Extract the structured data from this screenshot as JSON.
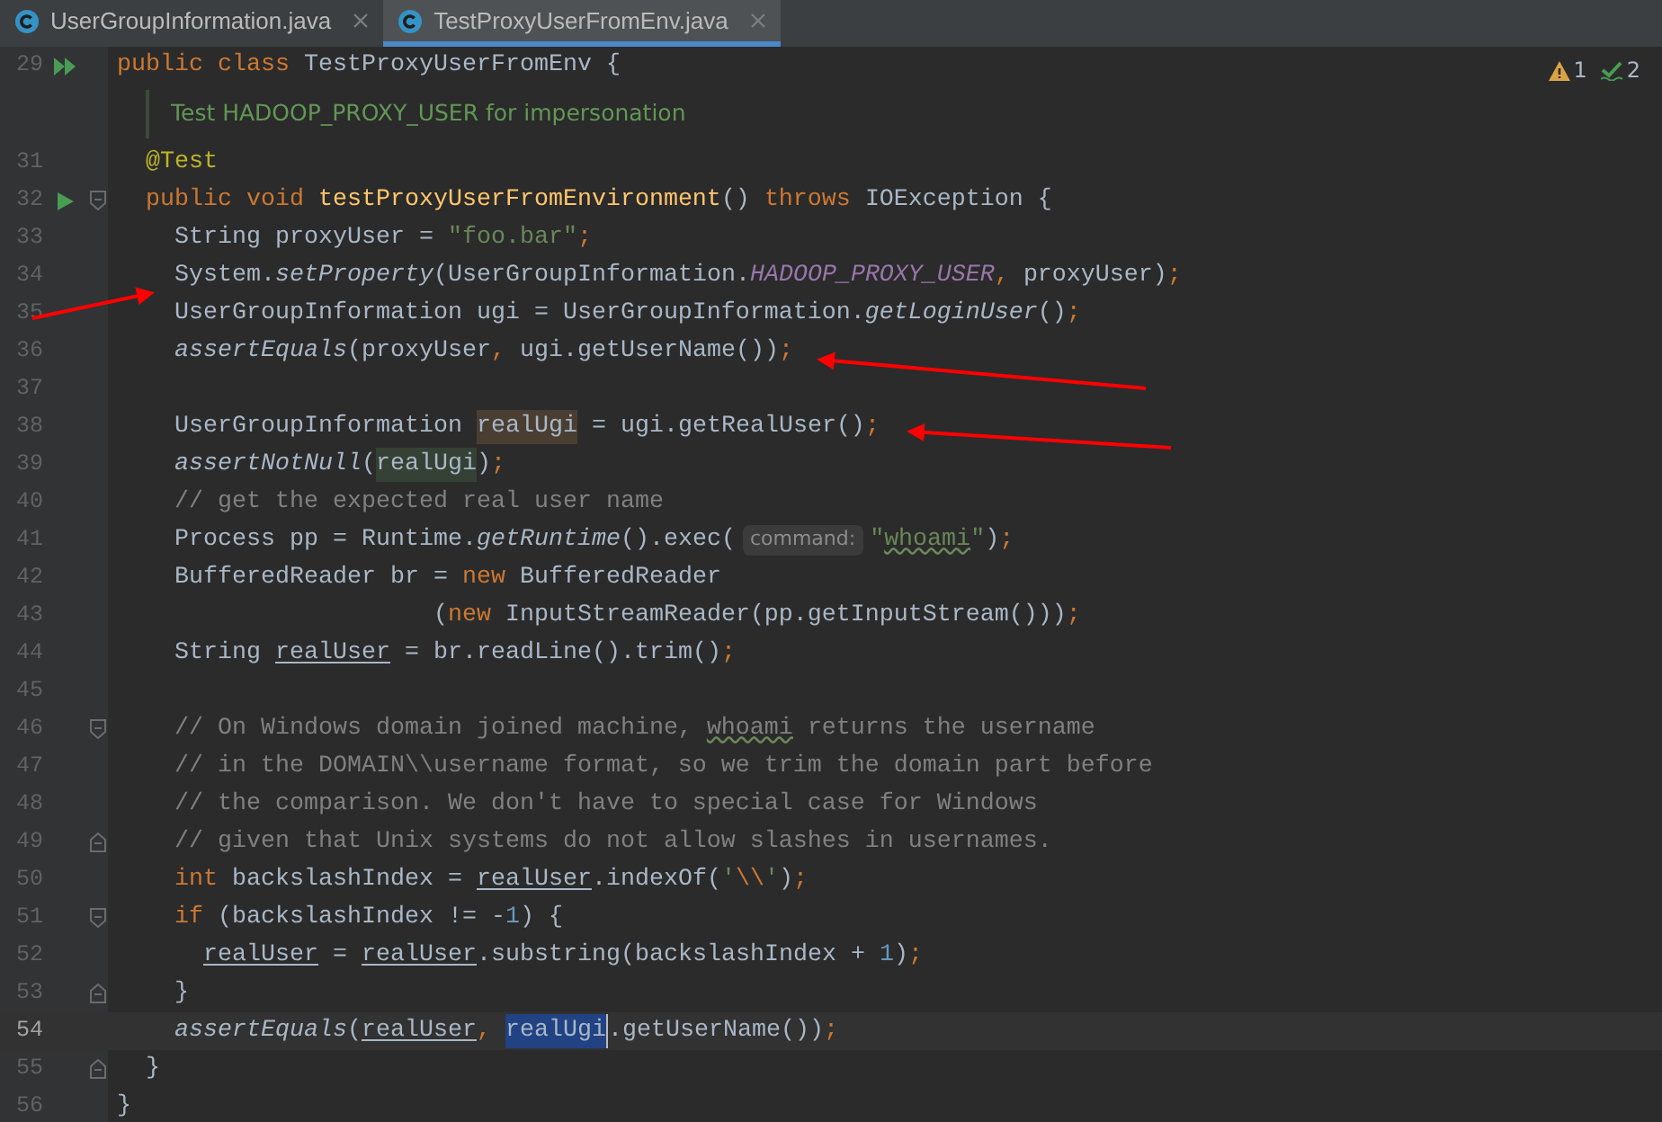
{
  "tabs": [
    {
      "label": "UserGroupInformation.java",
      "selected": false
    },
    {
      "label": "TestProxyUserFromEnv.java",
      "selected": true
    }
  ],
  "inspections": {
    "warnings": "1",
    "weak_warnings": "2"
  },
  "lines": [
    {
      "kind": "code",
      "number": "29",
      "run_all": true,
      "current": false,
      "tokens": [
        {
          "kind": "kw",
          "text": "public class "
        },
        {
          "kind": "plain",
          "text": "TestProxyUserFromEnv {"
        }
      ]
    },
    {
      "kind": "doc",
      "text": "Test HADOOP_PROXY_USER for impersonation"
    },
    {
      "kind": "code",
      "number": "31",
      "current": false,
      "tokens": [
        {
          "kind": "ann",
          "text": "  @Test"
        }
      ]
    },
    {
      "kind": "code",
      "number": "32",
      "run": true,
      "fold_start": true,
      "current": false,
      "tokens": [
        {
          "kind": "kw",
          "text": "  public void "
        },
        {
          "kind": "decl",
          "text": "testProxyUserFromEnvironment"
        },
        {
          "kind": "plain",
          "text": "() "
        },
        {
          "kind": "kw",
          "text": "throws "
        },
        {
          "kind": "plain",
          "text": "IOException {"
        }
      ]
    },
    {
      "kind": "code",
      "number": "33",
      "current": false,
      "tokens": [
        {
          "kind": "plain",
          "text": "    String proxyUser = "
        },
        {
          "kind": "str",
          "text": "\"foo.bar\""
        },
        {
          "kind": "kw",
          "text": ";"
        }
      ]
    },
    {
      "kind": "code",
      "number": "34",
      "current": false,
      "tokens": [
        {
          "kind": "plain",
          "text": "    System."
        },
        {
          "kind": "static",
          "text": "setProperty"
        },
        {
          "kind": "plain",
          "text": "(UserGroupInformation."
        },
        {
          "kind": "const",
          "text": "HADOOP_PROXY_USER"
        },
        {
          "kind": "kw",
          "text": ","
        },
        {
          "kind": "plain",
          "text": " proxyUser)"
        },
        {
          "kind": "kw",
          "text": ";"
        }
      ]
    },
    {
      "kind": "code",
      "number": "35",
      "current": false,
      "tokens": [
        {
          "kind": "plain",
          "text": "    UserGroupInformation ugi = UserGroupInformation."
        },
        {
          "kind": "static",
          "text": "getLoginUser"
        },
        {
          "kind": "plain",
          "text": "()"
        },
        {
          "kind": "kw",
          "text": ";"
        }
      ]
    },
    {
      "kind": "code",
      "number": "36",
      "current": false,
      "tokens": [
        {
          "kind": "static",
          "text": "    assertEquals"
        },
        {
          "kind": "plain",
          "text": "(proxyUser"
        },
        {
          "kind": "kw",
          "text": ","
        },
        {
          "kind": "plain",
          "text": " ugi.getUserName())"
        },
        {
          "kind": "kw",
          "text": ";"
        }
      ]
    },
    {
      "kind": "code",
      "number": "37",
      "current": false
    },
    {
      "kind": "code",
      "number": "38",
      "current": false,
      "tokens": [
        {
          "kind": "plain",
          "text": "    UserGroupInformation "
        },
        {
          "kind": "plain",
          "text": "realUgi",
          "write_highlight": true
        },
        {
          "kind": "plain",
          "text": " = ugi.getRealUser()"
        },
        {
          "kind": "kw",
          "text": ";"
        }
      ]
    },
    {
      "kind": "code",
      "number": "39",
      "current": false,
      "tokens": [
        {
          "kind": "static",
          "text": "    assertNotNull"
        },
        {
          "kind": "plain",
          "text": "("
        },
        {
          "kind": "plain",
          "text": "realUgi",
          "read_highlight": true
        },
        {
          "kind": "plain",
          "text": ")"
        },
        {
          "kind": "kw",
          "text": ";"
        }
      ]
    },
    {
      "kind": "code",
      "number": "40",
      "current": false,
      "tokens": [
        {
          "kind": "cmt",
          "text": "    // get the expected real user name"
        }
      ]
    },
    {
      "kind": "code",
      "number": "41",
      "current": false,
      "tokens": [
        {
          "kind": "plain",
          "text": "    Process pp = Runtime."
        },
        {
          "kind": "static",
          "text": "getRuntime"
        },
        {
          "kind": "plain",
          "text": "().exec("
        },
        {
          "kind": "hint",
          "text": "command:"
        },
        {
          "kind": "str",
          "text": "\""
        },
        {
          "kind": "str",
          "text": "whoami",
          "typo": true
        },
        {
          "kind": "str",
          "text": "\""
        },
        {
          "kind": "plain",
          "text": ")"
        },
        {
          "kind": "kw",
          "text": ";"
        }
      ]
    },
    {
      "kind": "code",
      "number": "42",
      "current": false,
      "tokens": [
        {
          "kind": "plain",
          "text": "    BufferedReader br = "
        },
        {
          "kind": "kw",
          "text": "new "
        },
        {
          "kind": "plain",
          "text": "BufferedReader"
        }
      ]
    },
    {
      "kind": "code",
      "number": "43",
      "current": false,
      "tokens": [
        {
          "kind": "plain",
          "text": "                      ("
        },
        {
          "kind": "kw",
          "text": "new "
        },
        {
          "kind": "plain",
          "text": "InputStreamReader(pp.getInputStream()))"
        },
        {
          "kind": "kw",
          "text": ";"
        }
      ]
    },
    {
      "kind": "code",
      "number": "44",
      "current": false,
      "tokens": [
        {
          "kind": "plain",
          "text": "    String "
        },
        {
          "kind": "var",
          "text": "realUser"
        },
        {
          "kind": "plain",
          "text": " = br.readLine().trim()"
        },
        {
          "kind": "kw",
          "text": ";"
        }
      ]
    },
    {
      "kind": "code",
      "number": "45",
      "current": false
    },
    {
      "kind": "code",
      "number": "46",
      "fold_start": true,
      "current": false,
      "tokens": [
        {
          "kind": "cmt",
          "text": "    // On Windows domain joined machine,"
        },
        {
          "kind": "cmt",
          "text": " whoami",
          "typo": true
        },
        {
          "kind": "cmt",
          "text": " returns the username"
        }
      ]
    },
    {
      "kind": "code",
      "number": "47",
      "current": false,
      "tokens": [
        {
          "kind": "cmt",
          "text": "    // in the DOMAIN\\\\username format, so we trim the domain part before"
        }
      ]
    },
    {
      "kind": "code",
      "number": "48",
      "current": false,
      "tokens": [
        {
          "kind": "cmt",
          "text": "    // the comparison. We don't have to special case for Windows"
        }
      ]
    },
    {
      "kind": "code",
      "number": "49",
      "fold_end": true,
      "current": false,
      "tokens": [
        {
          "kind": "cmt",
          "text": "    // given that Unix systems do not allow slashes in usernames."
        }
      ]
    },
    {
      "kind": "code",
      "number": "50",
      "current": false,
      "tokens": [
        {
          "kind": "kw",
          "text": "    int "
        },
        {
          "kind": "plain",
          "text": "backslashIndex = "
        },
        {
          "kind": "var",
          "text": "realUser"
        },
        {
          "kind": "plain",
          "text": ".indexOf("
        },
        {
          "kind": "str",
          "text": "'"
        },
        {
          "kind": "kw",
          "text": "\\\\"
        },
        {
          "kind": "str",
          "text": "'"
        },
        {
          "kind": "plain",
          "text": ")"
        },
        {
          "kind": "kw",
          "text": ";"
        }
      ]
    },
    {
      "kind": "code",
      "number": "51",
      "fold_start": true,
      "current": false,
      "tokens": [
        {
          "kind": "kw",
          "text": "    if "
        },
        {
          "kind": "plain",
          "text": "(backslashIndex != -"
        },
        {
          "kind": "num",
          "text": "1"
        },
        {
          "kind": "plain",
          "text": ") {"
        }
      ]
    },
    {
      "kind": "code",
      "number": "52",
      "current": false,
      "tokens": [
        {
          "kind": "var",
          "text": "      realUser"
        },
        {
          "kind": "plain",
          "text": " = "
        },
        {
          "kind": "var",
          "text": "realUser"
        },
        {
          "kind": "plain",
          "text": ".substring(backslashIndex + "
        },
        {
          "kind": "num",
          "text": "1"
        },
        {
          "kind": "plain",
          "text": ")"
        },
        {
          "kind": "kw",
          "text": ";"
        }
      ]
    },
    {
      "kind": "code",
      "number": "53",
      "fold_end": true,
      "current": false,
      "tokens": [
        {
          "kind": "plain",
          "text": "    }"
        }
      ]
    },
    {
      "kind": "code",
      "number": "54",
      "current": true,
      "tokens": [
        {
          "kind": "static",
          "text": "    assertEquals"
        },
        {
          "kind": "plain",
          "text": "("
        },
        {
          "kind": "var",
          "text": "realUser"
        },
        {
          "kind": "kw",
          "text": ", "
        },
        {
          "kind": "plain",
          "text": "realUgi",
          "selected": true
        },
        {
          "kind": "plain",
          "text": ".getUserName())"
        },
        {
          "kind": "kw",
          "text": ";"
        }
      ]
    },
    {
      "kind": "code",
      "number": "55",
      "fold_end": true,
      "current": false,
      "tokens": [
        {
          "kind": "plain",
          "text": "  }"
        }
      ]
    },
    {
      "kind": "code",
      "number": "56",
      "current": false,
      "tokens": [
        {
          "kind": "plain",
          "text": "}"
        }
      ]
    }
  ]
}
